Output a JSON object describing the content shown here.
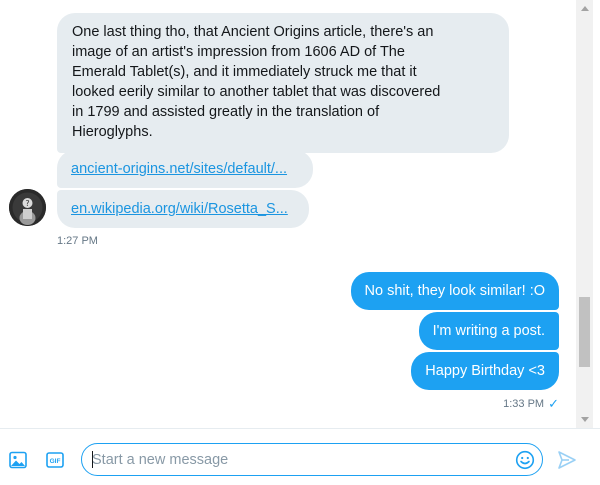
{
  "thread": {
    "incoming": {
      "message": "One last thing tho, that Ancient Origins article, there's an\nimage of an artist's impression from 1606 AD of The\nEmerald Tablet(s), and it immediately struck me that it\nlooked eerily similar to another tablet that was discovered\nin 1799 and assisted greatly in the translation of\nHieroglyphs.",
      "link1": "ancient-origins.net/sites/default/...",
      "link2": "en.wikipedia.org/wiki/Rosetta_S...",
      "time": "1:27 PM"
    },
    "outgoing": {
      "messages": [
        "No shit, they look similar! :O",
        "I'm writing a post.",
        "Happy Birthday <3"
      ],
      "time": "1:33 PM",
      "read_icon": "checkmark-icon"
    }
  },
  "composer": {
    "placeholder": "Start a new message",
    "value": "",
    "gif_label": "GIF"
  },
  "colors": {
    "accent": "#1da1f2",
    "incoming_bubble": "#e6ecf0",
    "link": "#1b95e0",
    "muted": "#657786"
  }
}
